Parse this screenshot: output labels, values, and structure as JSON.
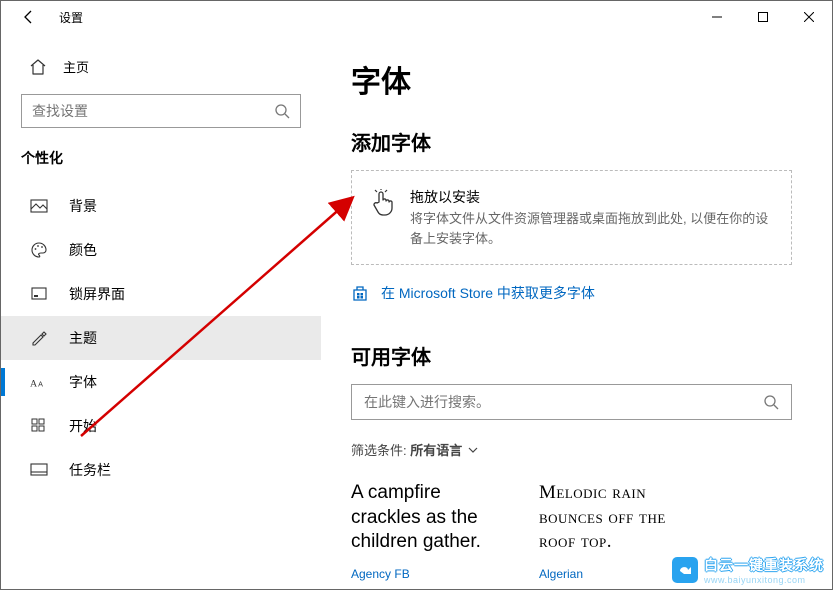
{
  "window": {
    "title": "设置"
  },
  "sidebar": {
    "home_label": "主页",
    "search_placeholder": "查找设置",
    "category_label": "个性化",
    "items": [
      {
        "label": "背景"
      },
      {
        "label": "颜色"
      },
      {
        "label": "锁屏界面"
      },
      {
        "label": "主题"
      },
      {
        "label": "字体"
      },
      {
        "label": "开始"
      },
      {
        "label": "任务栏"
      }
    ]
  },
  "content": {
    "page_title": "字体",
    "add_fonts_heading": "添加字体",
    "drop_title": "拖放以安装",
    "drop_desc": "将字体文件从文件资源管理器或桌面拖放到此处, 以便在你的设备上安装字体。",
    "store_link": "在 Microsoft Store 中获取更多字体",
    "available_heading": "可用字体",
    "font_search_placeholder": "在此键入进行搜索。",
    "filter_label": "筛选条件:",
    "filter_value": "所有语言",
    "tiles": [
      {
        "sample": "A campfire crackles as the children gather.",
        "name": "Agency FB"
      },
      {
        "sample": "Melodic rain bounces off the roof top.",
        "name": "Algerian"
      }
    ]
  },
  "watermark": {
    "main": "白云一键重装系统",
    "sub": "www.baiyunxitong.com"
  }
}
